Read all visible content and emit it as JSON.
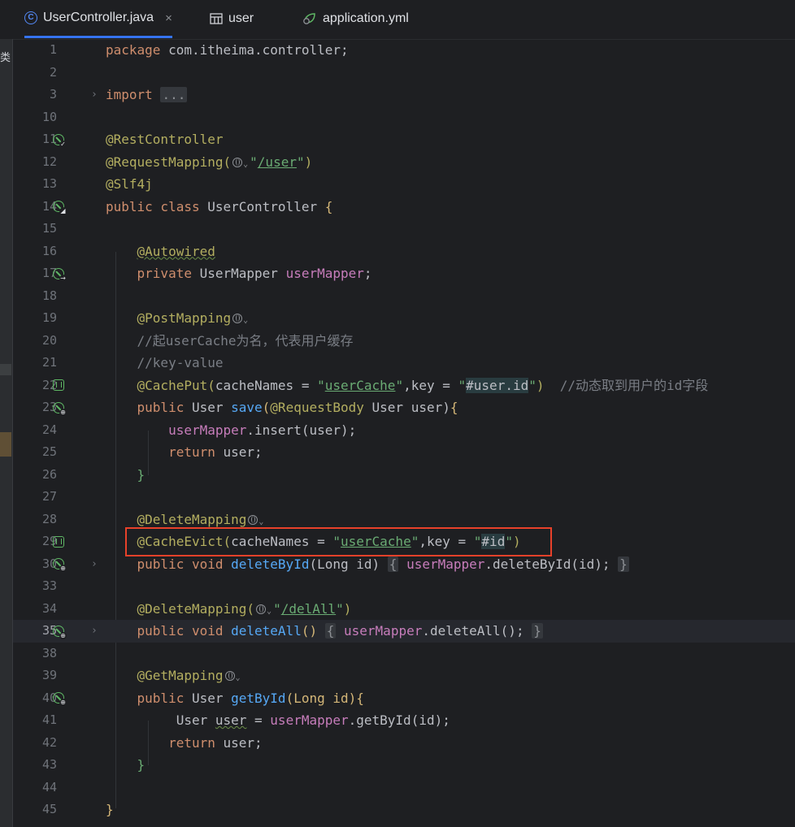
{
  "tabs": [
    {
      "label": "UserController.java",
      "icon": "java-class-icon",
      "active": true,
      "close": "×"
    },
    {
      "label": "user",
      "icon": "table-icon",
      "active": false
    },
    {
      "label": "application.yml",
      "icon": "spring-config-icon",
      "active": false
    }
  ],
  "left_strip_text": "类",
  "lines": [
    {
      "n": "1"
    },
    {
      "n": "2"
    },
    {
      "n": "3"
    },
    {
      "n": "10"
    },
    {
      "n": "11"
    },
    {
      "n": "12"
    },
    {
      "n": "13"
    },
    {
      "n": "14"
    },
    {
      "n": "15"
    },
    {
      "n": "16"
    },
    {
      "n": "17"
    },
    {
      "n": "18"
    },
    {
      "n": "19"
    },
    {
      "n": "20"
    },
    {
      "n": "21"
    },
    {
      "n": "22"
    },
    {
      "n": "23"
    },
    {
      "n": "24"
    },
    {
      "n": "25"
    },
    {
      "n": "26"
    },
    {
      "n": "27"
    },
    {
      "n": "28"
    },
    {
      "n": "29"
    },
    {
      "n": "30"
    },
    {
      "n": "33"
    },
    {
      "n": "34"
    },
    {
      "n": "35"
    },
    {
      "n": "38"
    },
    {
      "n": "39"
    },
    {
      "n": "40"
    },
    {
      "n": "41"
    },
    {
      "n": "42"
    },
    {
      "n": "43"
    },
    {
      "n": "44"
    },
    {
      "n": "45"
    }
  ],
  "code": {
    "pkg_kw": "package",
    "pkg_name": " com.itheima.controller;",
    "import_kw": "import",
    "import_fold": "...",
    "ann_rest": "@RestController",
    "ann_reqmap": "@RequestMapping(",
    "reqmap_path": "/user",
    "ann_slf4j": "@Slf4j",
    "class_kw": "public class",
    "class_name": " UserController ",
    "brace_open": "{",
    "ann_autowired": "@Autowired",
    "private_kw": "private",
    "mapper_type": " UserMapper ",
    "mapper_field": "userMapper",
    "semicolon": ";",
    "ann_post": "@PostMapping",
    "comment_1": "//起userCache为名，代表用户缓存",
    "comment_2": "//key-value",
    "ann_cacheput": "@CachePut(",
    "cacheput_args1": "cacheNames = ",
    "cache_name": "userCache",
    "cacheput_args2": ",key = ",
    "key_user_id": "#user.id",
    "comment_3": "//动态取到用户的id字段",
    "public_kw": "public",
    "user_type": " User ",
    "save_fn": "save",
    "ann_reqbody": "@RequestBody",
    "save_params": " User user)",
    "insert_call": ".insert(user);",
    "return_kw": "return",
    "return_user": " user;",
    "brace_close": "}",
    "ann_delete": "@DeleteMapping",
    "ann_cacheevict": "@CacheEvict(",
    "key_id": "#id",
    "void_kw": " void ",
    "delete_fn": "deleteById",
    "delete_params": "(Long id) ",
    "delete_body": ".deleteById(id);",
    "delall_path": "/delAll",
    "delall_fn": "deleteAll",
    "delall_body": ".deleteAll();",
    "ann_get": "@GetMapping",
    "get_fn": "getById",
    "get_params": "(Long id)",
    "user_var": "user",
    "get_body": ".getById(id);",
    "eq": " = ",
    "open_paren": "(",
    "close_paren": ")",
    "quote": "\"",
    "empty_parens": "()"
  },
  "colors": {
    "background": "#1e1f22",
    "keyword": "#cf8e6d",
    "annotation": "#b3ae60",
    "string": "#6aab73",
    "field": "#c77dbb",
    "method": "#56a8f5",
    "comment": "#7a7e85",
    "highlight_box": "#e8412a"
  }
}
